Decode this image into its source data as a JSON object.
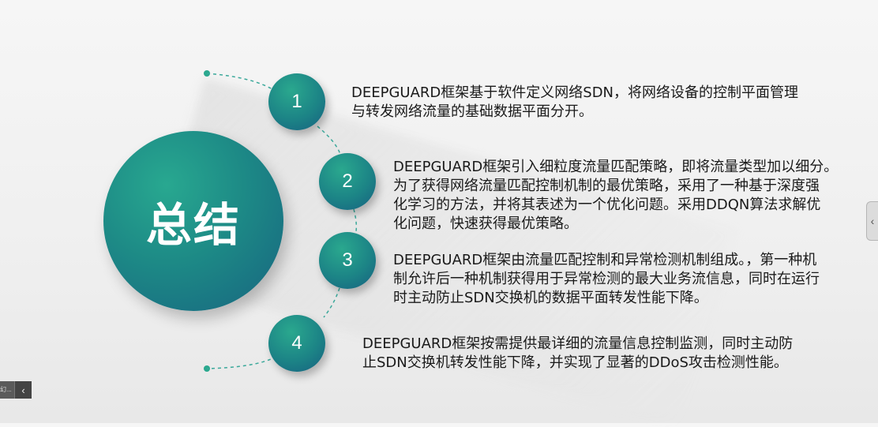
{
  "slide": {
    "title": "总结",
    "points": [
      {
        "number": "1",
        "lines": [
          "DEEPGUARD框架基于软件定义网络SDN，将网络设备的控制平面管理",
          "与转发网络流量的基础数据平面分开。"
        ]
      },
      {
        "number": "2",
        "lines": [
          "DEEPGUARD框架引入细粒度流量匹配策略，即将流量类型加以细分。",
          "为了获得网络流量匹配控制机制的最优策略，采用了一种基于深度强",
          "化学习的方法，并将其表述为一个优化问题。采用DDQN算法求解优",
          "化问题，快速获得最优策略。"
        ]
      },
      {
        "number": "3",
        "lines": [
          "DEEPGUARD框架由流量匹配控制和异常检测机制组成。，第一种机",
          "制允许后一种机制获得用于异常检测的最大业务流信息，同时在运行",
          "时主动防止SDN交换机的数据平面转发性能下降。"
        ]
      },
      {
        "number": "4",
        "lines": [
          "DEEPGUARD框架按需提供最详细的流量信息控制监测，同时主动防",
          "止SDN交换机转发性能下降，并实现了显著的DDoS攻击检测性能。"
        ]
      }
    ]
  },
  "controls": {
    "side_tab_icon": "chevron-left-icon",
    "side_tab_glyph": "‹",
    "bottom_thumb_label": "幻...",
    "bottom_nav_icon": "chevron-left-icon",
    "bottom_nav_glyph": "‹"
  },
  "colors": {
    "accent_teal": "#1d8a86",
    "accent_green": "#28a890",
    "accent_blue": "#176480",
    "text": "#1a1a1a"
  }
}
